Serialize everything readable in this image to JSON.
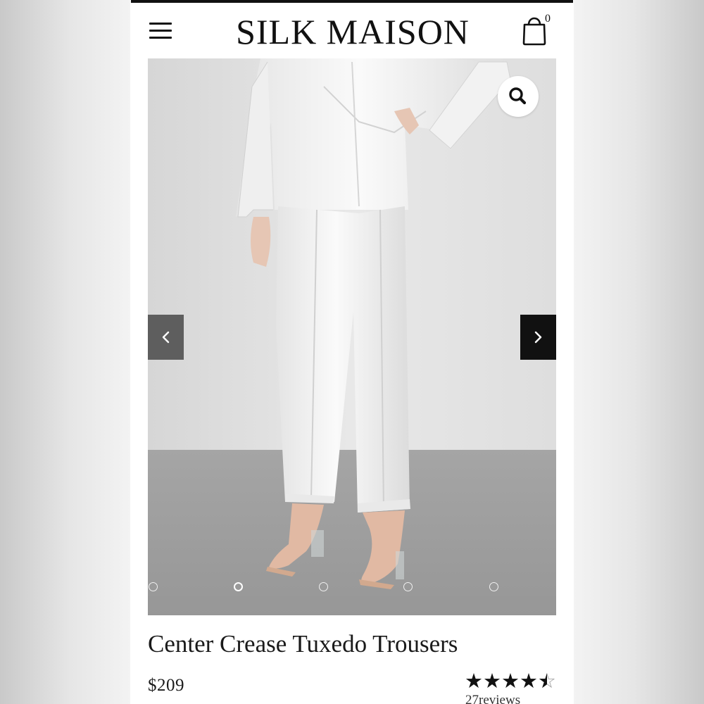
{
  "header": {
    "brand": "SILK MAISON",
    "cart_count": "0",
    "menu_icon": "hamburger-menu-icon",
    "cart_icon": "shopping-bag-icon"
  },
  "gallery": {
    "zoom_icon": "magnifier-icon",
    "prev_icon": "chevron-left-icon",
    "next_icon": "chevron-right-icon",
    "slide_count": 5,
    "active_slide": 2
  },
  "product": {
    "title": "Center Crease Tuxedo Trousers",
    "price": "$209",
    "rating": 4.5,
    "rating_max": 5,
    "reviews_label": "27reviews"
  },
  "colors": {
    "ink": "#111111",
    "background": "#ffffff",
    "photo_wall": "#e2e2e2",
    "photo_floor": "#9e9e9e"
  }
}
